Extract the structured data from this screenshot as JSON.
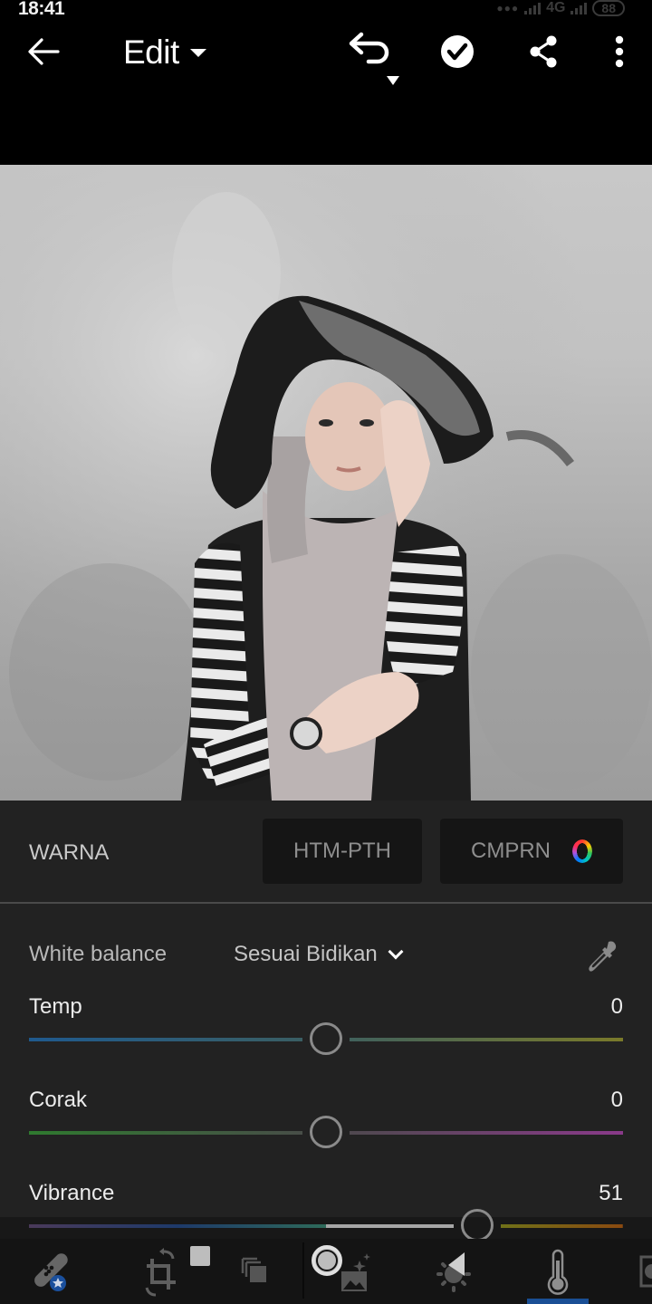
{
  "status_bar": {
    "time": "18:41",
    "network": "4G",
    "battery": "88"
  },
  "app_bar": {
    "title": "Edit",
    "icons": {
      "back": "arrow-left-icon",
      "title_menu": "caret-down-icon",
      "undo": "undo-icon",
      "undo_menu": "caret-down-icon",
      "done": "checkmark-circle-icon",
      "share": "share-icon",
      "more": "more-vertical-icon"
    }
  },
  "photo": {
    "description": "Edited portrait: woman in grey hijab, black wide-brim hat, striped shirt and black vest against a grey concrete wall"
  },
  "panel": {
    "section_title": "WARNA",
    "bw_button": "HTM-PTH",
    "profile_button": "CMPRN",
    "profile_icon": "color-wheel-icon",
    "white_balance": {
      "label": "White balance",
      "selected": "Sesuai Bidikan",
      "eyedropper_icon": "eyedropper-icon"
    },
    "sliders": [
      {
        "label": "Temp",
        "value": "0",
        "fraction": 0.5,
        "colors": [
          "#1f5a8e",
          "#3c5f60",
          "#7a7a2a"
        ]
      },
      {
        "label": "Corak",
        "value": "0",
        "fraction": 0.5,
        "colors": [
          "#2f7a2f",
          "#4a4a4a",
          "#8a3a8a"
        ]
      },
      {
        "label": "Vibrance",
        "value": "51",
        "fraction": 0.755,
        "colors": [
          "#4a3a5a",
          "#1e3a6a",
          "#2e6a5a",
          "#6a7a1a",
          "#8a4a10"
        ]
      }
    ]
  },
  "toolbar": {
    "tools": [
      {
        "name": "healing",
        "icon": "bandage-icon",
        "badge": "premium-star-badge"
      },
      {
        "name": "crop",
        "icon": "crop-rotate-icon"
      },
      {
        "name": "presets",
        "icon": "presets-stack-icon"
      },
      {
        "name": "auto",
        "icon": "auto-enhance-icon"
      },
      {
        "name": "light",
        "icon": "light-sun-icon"
      },
      {
        "name": "color",
        "icon": "thermometer-icon",
        "active": true
      },
      {
        "name": "effects",
        "icon": "effects-icon"
      }
    ]
  }
}
